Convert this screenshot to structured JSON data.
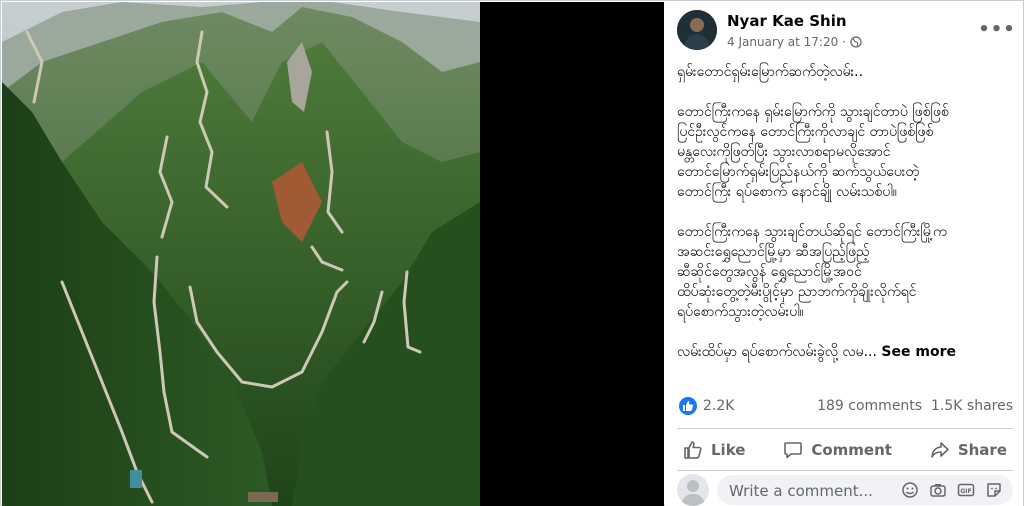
{
  "post": {
    "author": "Nyar Kae Shin",
    "timestamp": "4 January at 17:20",
    "privacy_icon": "globe-icon",
    "more_icon": "more-options-icon",
    "paragraphs": [
      "ရှမ်းတောင်ရှမ်းမြောက်ဆက်တဲ့လမ်း..",
      "တောင်ကြီးကနေ ရှမ်းမြောက်ကို သွားချင်တာပဲ ဖြစ်ဖြစ်\nပြင်ဦးလွင်ကနေ တောင်ကြီးကိုလာချင် တာပဲဖြစ်ဖြစ်\nမန္တလေးကိုဖြတ်ပြီး သွားလာစရာမလိုအောင်\nတောင်မြောက်ရှမ်းပြည်နယ်ကို ဆက်သွယ်ပေးတဲ့\nတောင်ကြီး ရပ်စောက် နောင်ချို လမ်းသစ်ပါ။",
      "တောင်ကြီးကနေ သွားချင်တယ်ဆိုရင် တောင်ကြီးမြို့က\nအဆင်းရွှေညောင်မြို့မှာ ဆီအပြည့်ဖြည့်\nဆီဆိုင်တွေအလွန် ရွှေညောင်မြို့အဝင်\nထိပ်ဆုံးတွေ့တဲ့မီးပွိုင့်မှာ ညာဘက်ကိုချိုးလိုက်ရင်\nရပ်စောက်သွားတဲ့လမ်းပါ။"
    ],
    "truncated_line": "လမ်းထိပ်မှာ ရပ်စောက်လမ်းခွဲလို့ လမ...",
    "see_more": "See more"
  },
  "stats": {
    "reactions": "2.2K",
    "comments": "189 comments",
    "shares": "1.5K shares"
  },
  "actions": {
    "like": "Like",
    "comment": "Comment",
    "share": "Share"
  },
  "comment_box": {
    "placeholder": "Write a comment..."
  },
  "colors": {
    "accent": "#1877f2",
    "secondary_text": "#65676b",
    "divider": "#ced0d4",
    "photo_letterbox": "#000000"
  }
}
